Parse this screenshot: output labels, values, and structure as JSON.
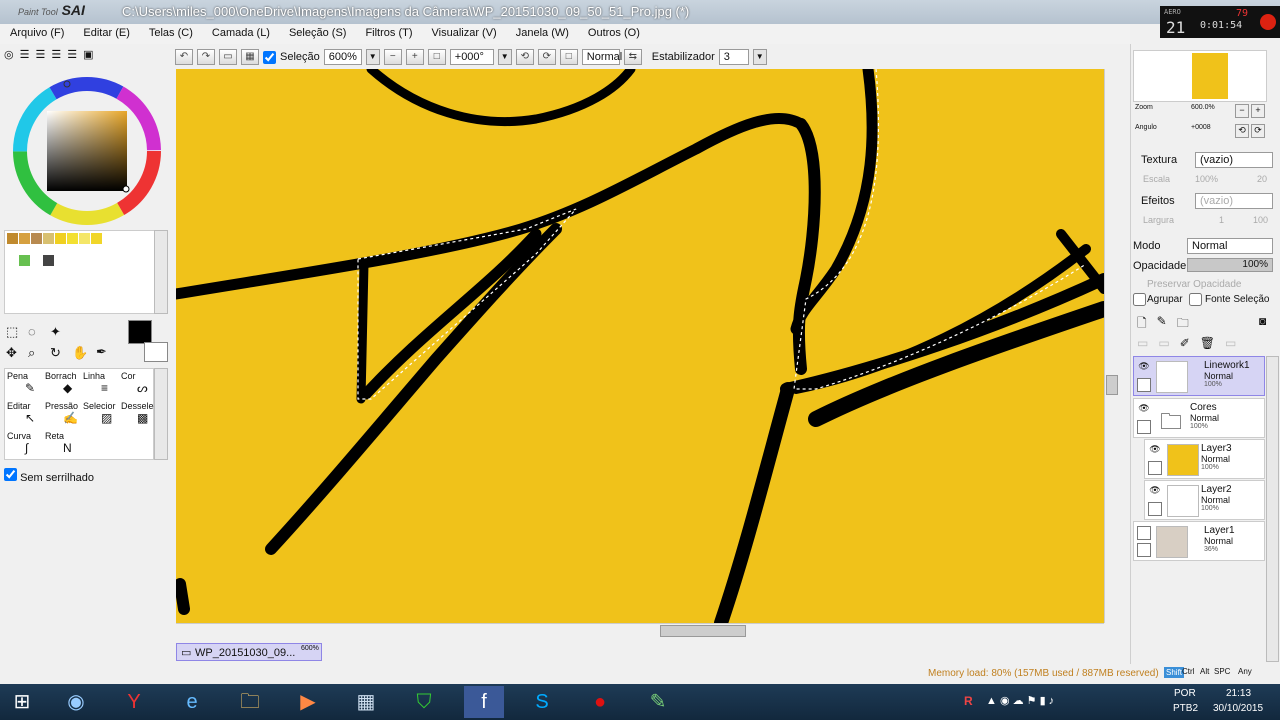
{
  "app": {
    "logo": "SAI",
    "logo_small": "Paint Tool",
    "window_title": "C:\\Users\\miles_000\\OneDrive\\Imagens\\Imagens da Câmera\\WP_20151030_09_50_51_Pro.jpg (*)"
  },
  "aero_clock": {
    "top": "AERO",
    "big": "21",
    "time": "0:01:54",
    "num": "79"
  },
  "menu": [
    "Arquivo (F)",
    "Editar (E)",
    "Telas (C)",
    "Camada (L)",
    "Seleção (S)",
    "Filtros (T)",
    "Visualizar (V)",
    "Janela (W)",
    "Outros (O)"
  ],
  "toolbar": {
    "selecao_label": "Seleção",
    "zoom": "600%",
    "angle": "+000°",
    "mode": "Normal",
    "stabilizer_label": "Estabilizador",
    "stabilizer_value": "3"
  },
  "color_swatches": [
    "#c08a2e",
    "#d6a040",
    "#b88a50",
    "#d8c070",
    "#f0d020",
    "#f3e030",
    "#f4e668",
    "#f1d629",
    "#67c050",
    "#444444"
  ],
  "tools": {
    "primary_color": "#000000",
    "brushes": [
      {
        "name": "Pena"
      },
      {
        "name": "Borrach"
      },
      {
        "name": "Linha"
      },
      {
        "name": "Cor"
      },
      {
        "name": "Editar"
      },
      {
        "name": "Pressão"
      },
      {
        "name": "Selecior"
      },
      {
        "name": "Desselec"
      },
      {
        "name": "Curva"
      },
      {
        "name": "Reta"
      }
    ],
    "antialias_label": "Sem serrilhado"
  },
  "navigator": {
    "zoom_label": "Zoom",
    "zoom_value": "600.0%",
    "angle_label": "Angulo",
    "angle_value": "+0008"
  },
  "layer_props": {
    "textura_label": "Textura",
    "textura_value": "(vazio)",
    "escala_label": "Escala",
    "escala_value": "100%",
    "escala_num": "20",
    "efeitos_label": "Efeitos",
    "efeitos_value": "(vazio)",
    "largura_label": "Largura",
    "largura_value": "1",
    "largura_num": "100",
    "modo_label": "Modo",
    "modo_value": "Normal",
    "opacidade_label": "Opacidade",
    "opacidade_value": "100%",
    "preservar_label": "Preservar Opacidade",
    "agrupar_label": "Agrupar",
    "fonte_label": "Fonte Seleção"
  },
  "layers": [
    {
      "name": "Linework1",
      "mode": "Normal",
      "pct": "100%",
      "selected": true,
      "thumb": "#ffffff"
    },
    {
      "name": "Cores",
      "mode": "Normal",
      "pct": "100%",
      "selected": false,
      "folder": true
    },
    {
      "name": "Layer3",
      "mode": "Normal",
      "pct": "100%",
      "selected": false,
      "thumb": "#f0c21a"
    },
    {
      "name": "Layer2",
      "mode": "Normal",
      "pct": "100%",
      "selected": false,
      "thumb": "#ffffff"
    },
    {
      "name": "Layer1",
      "mode": "Normal",
      "pct": "36%",
      "selected": false,
      "thumb": "#d8cfc4"
    }
  ],
  "doc_tab": {
    "name": "WP_20151030_09...",
    "zoom": "600%"
  },
  "status": {
    "memory": "Memory load: 80% (157MB used / 887MB reserved)",
    "keys": [
      "Shift",
      "Ctrl",
      "Alt",
      "SPC",
      "Any"
    ]
  },
  "taskbar": {
    "lang": "POR",
    "lang2": "PTB2",
    "time": "21:13",
    "date": "30/10/2015"
  },
  "colors": {
    "canvas": "#f0c21a",
    "accent": "#8f86e6",
    "memory_text": "#c08020"
  }
}
